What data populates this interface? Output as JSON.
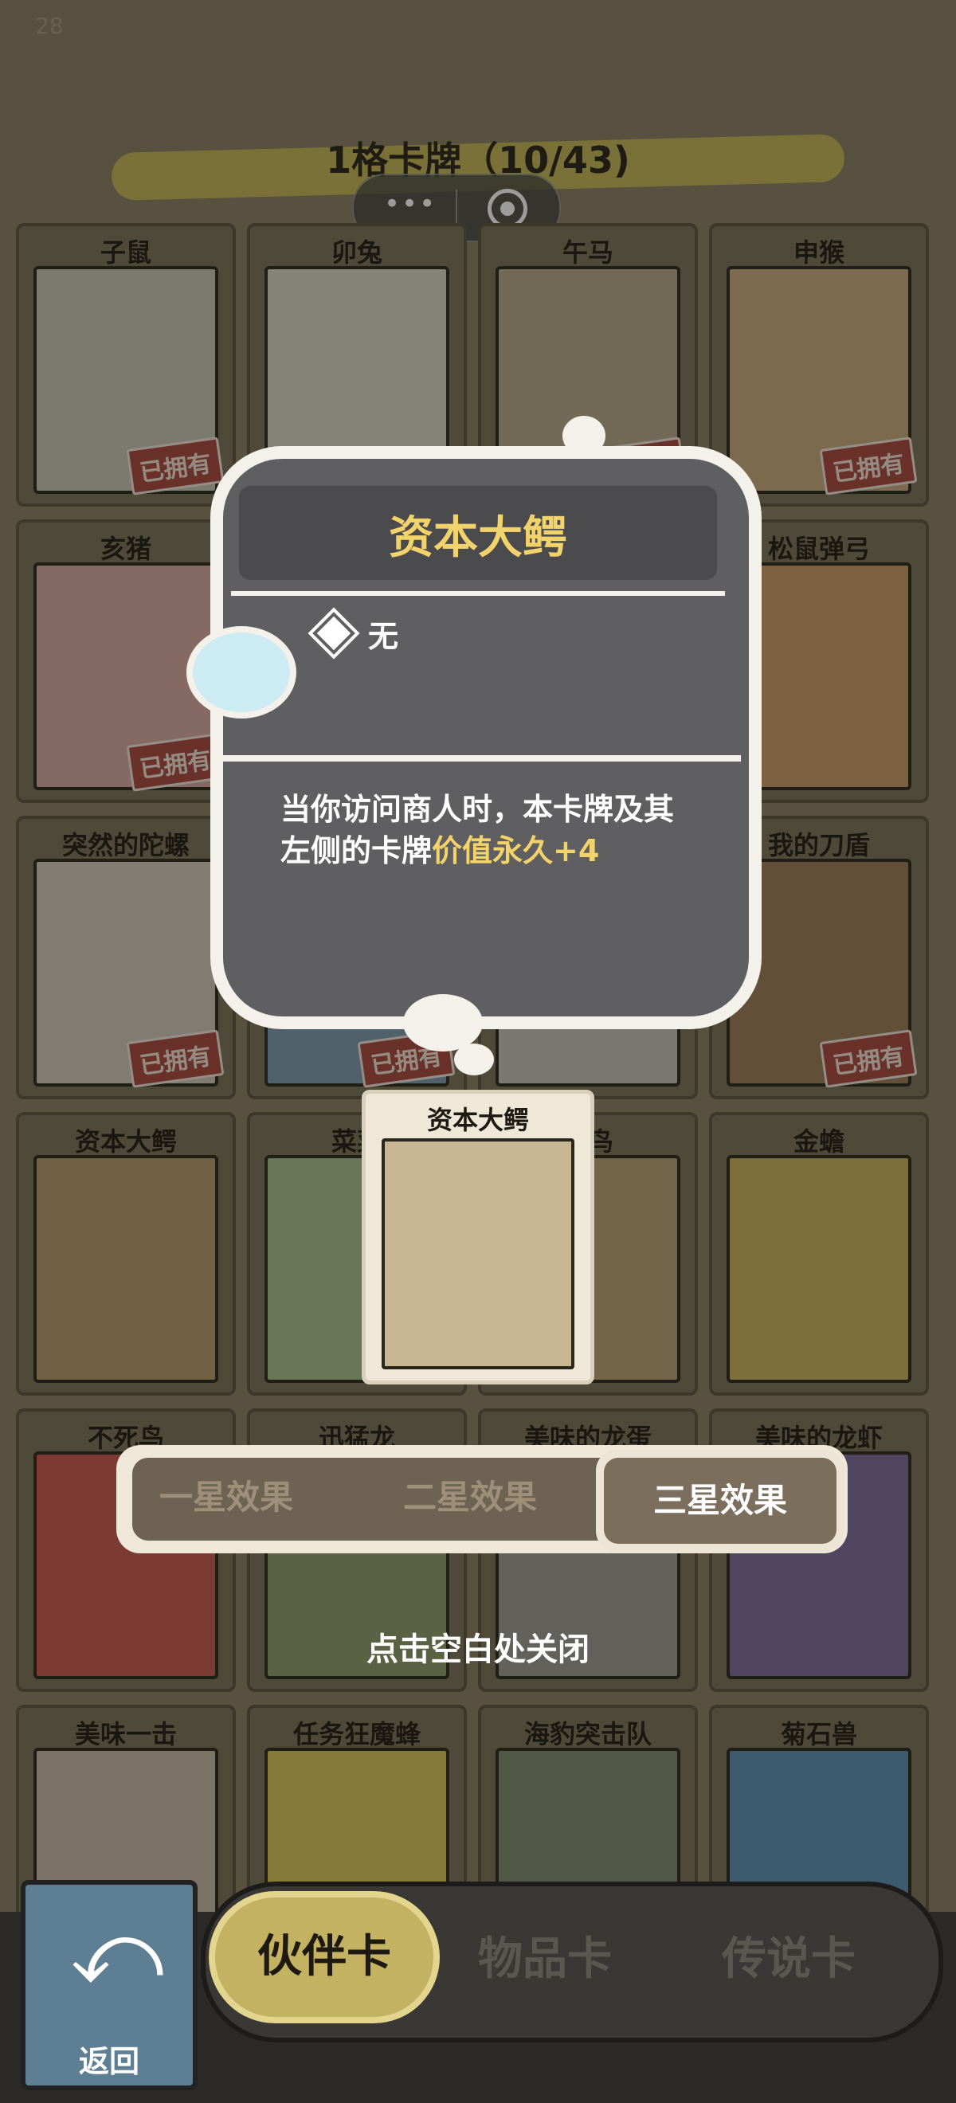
{
  "status": {
    "fps": "28"
  },
  "header": {
    "title": "1格卡牌（10/43)"
  },
  "cards": [
    {
      "name": "子鼠",
      "owned": true,
      "color": "#c9c4b4"
    },
    {
      "name": "卯兔",
      "owned": false,
      "color": "#d8d3c6"
    },
    {
      "name": "午马",
      "owned": true,
      "color": "#b8a88c"
    },
    {
      "name": "申猴",
      "owned": true,
      "color": "#c9a97c"
    },
    {
      "name": "亥猪",
      "owned": true,
      "color": "#d7a7a1"
    },
    {
      "name": "",
      "owned": false,
      "color": "#8a7f62"
    },
    {
      "name": "",
      "owned": false,
      "color": "#8a7f62"
    },
    {
      "name": "松鼠弹弓",
      "owned": false,
      "color": "#c99b6a"
    },
    {
      "name": "突然的陀螺",
      "owned": true,
      "color": "#cfc8bb"
    },
    {
      "name": "",
      "owned": true,
      "color": "#7c9ab0"
    },
    {
      "name": "",
      "owned": false,
      "color": "#c6c2ba"
    },
    {
      "name": "我的刀盾",
      "owned": true,
      "color": "#9a7a57"
    },
    {
      "name": "资本大鳄",
      "owned": false,
      "color": "#b89a6e"
    },
    {
      "name": "菜菜",
      "owned": false,
      "color": "#a8c08e"
    },
    {
      "name": "小鸟",
      "owned": false,
      "color": "#b69f74"
    },
    {
      "name": "金蟾",
      "owned": false,
      "color": "#c7b05c"
    },
    {
      "name": "不死鸟",
      "owned": false,
      "color": "#c7574c"
    },
    {
      "name": "迅猛龙",
      "owned": false,
      "color": "#8e9c6c"
    },
    {
      "name": "美味的龙蛋",
      "owned": false,
      "color": "#9d9a94"
    },
    {
      "name": "美味的龙虾",
      "owned": false,
      "color": "#7a6a9e"
    },
    {
      "name": "美味一击",
      "owned": false,
      "color": "#c9b8a8"
    },
    {
      "name": "任务狂魔蜂",
      "owned": false,
      "color": "#d8c45a"
    },
    {
      "name": "海豹突击队",
      "owned": false,
      "color": "#7f8a6e"
    },
    {
      "name": "菊石兽",
      "owned": false,
      "color": "#5e8db5"
    }
  ],
  "owned_label": "已拥有",
  "popup": {
    "title": "资本大鳄",
    "attribute": "无",
    "description_plain": "当你访问商人时，本卡牌及其左侧的卡牌",
    "description_highlight": "价值永久+4"
  },
  "selected_card": {
    "name": "资本大鳄"
  },
  "effect_tabs": {
    "tab1": "一星效果",
    "tab2": "二星效果",
    "tab3": "三星效果",
    "selected": "三星效果"
  },
  "close_hint": "点击空白处关闭",
  "bottom_nav": {
    "back": "返回",
    "companion": "伙伴卡",
    "item": "物品卡",
    "legend": "传说卡"
  },
  "colors": {
    "highlight": "#f2d26a",
    "owned_stamp": "#a8473e",
    "nav_selected": "#c3b261"
  }
}
